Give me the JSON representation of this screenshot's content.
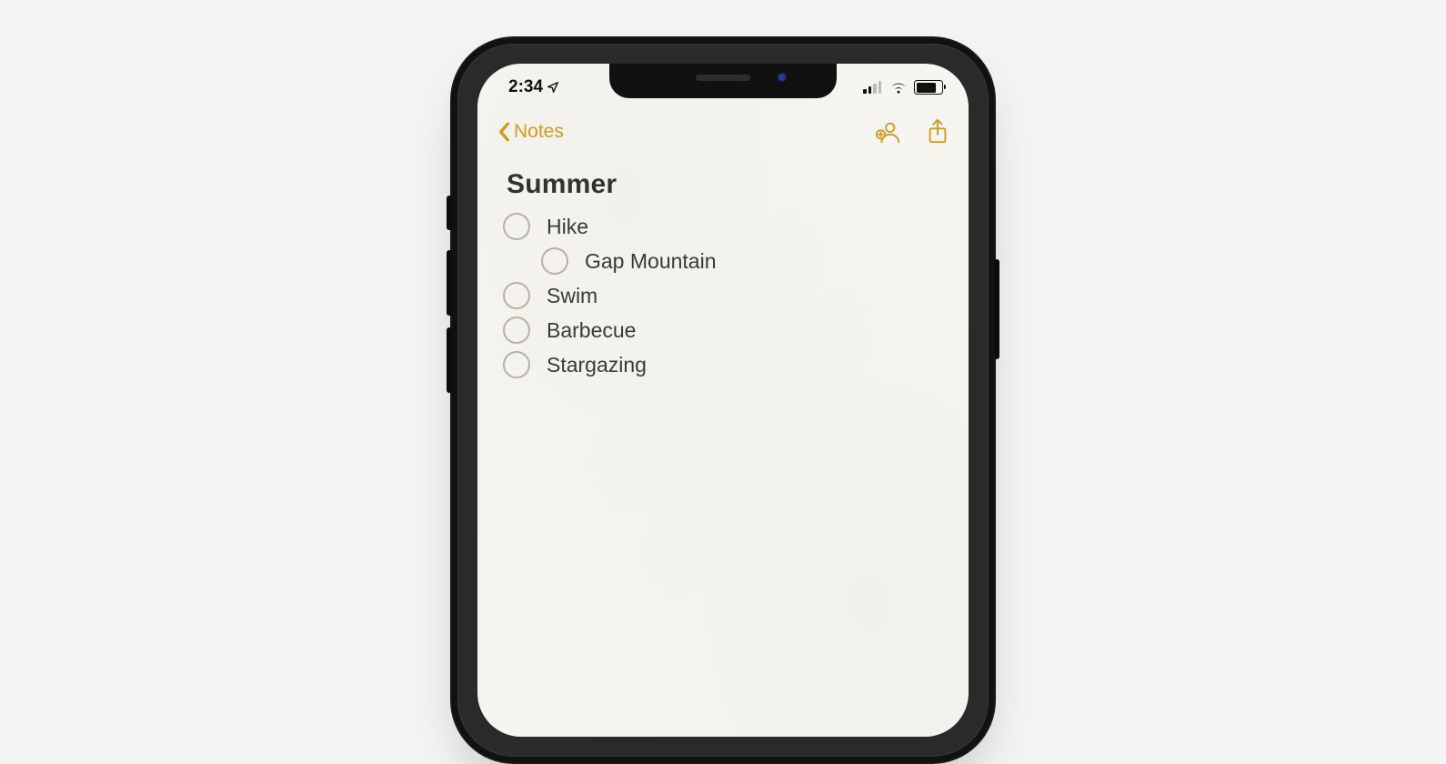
{
  "status": {
    "time": "2:34"
  },
  "nav": {
    "back_label": "Notes"
  },
  "note": {
    "title": "Summer",
    "items": [
      {
        "text": "Hike",
        "indent": 0
      },
      {
        "text": "Gap Mountain",
        "indent": 1
      },
      {
        "text": "Swim",
        "indent": 0
      },
      {
        "text": "Barbecue",
        "indent": 0
      },
      {
        "text": "Stargazing",
        "indent": 0
      }
    ]
  },
  "colors": {
    "accent": "#d39a1f"
  }
}
